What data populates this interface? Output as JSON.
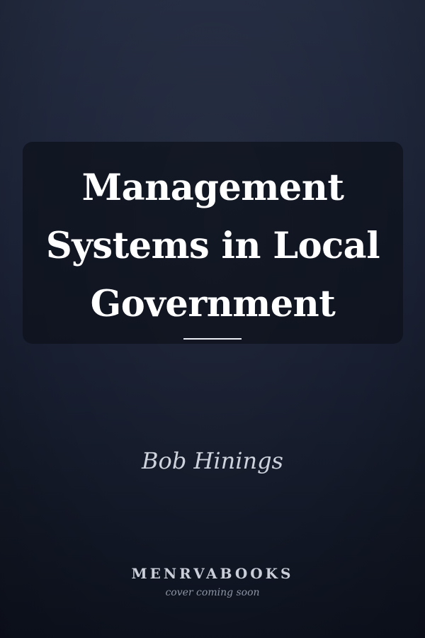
{
  "cover": {
    "title_lines": [
      "Management",
      "Systems in Local",
      "Government"
    ],
    "author": "Bob Hinings",
    "publisher": "MENRVABOOKS",
    "tagline": "cover coming soon"
  },
  "colors": {
    "background_top": "#232b40",
    "background_bottom": "#0e1320",
    "panel": "#0c101b",
    "title_text": "#ffffff",
    "author_text": "#cdd2dc",
    "tagline_text": "#8d94a3"
  }
}
